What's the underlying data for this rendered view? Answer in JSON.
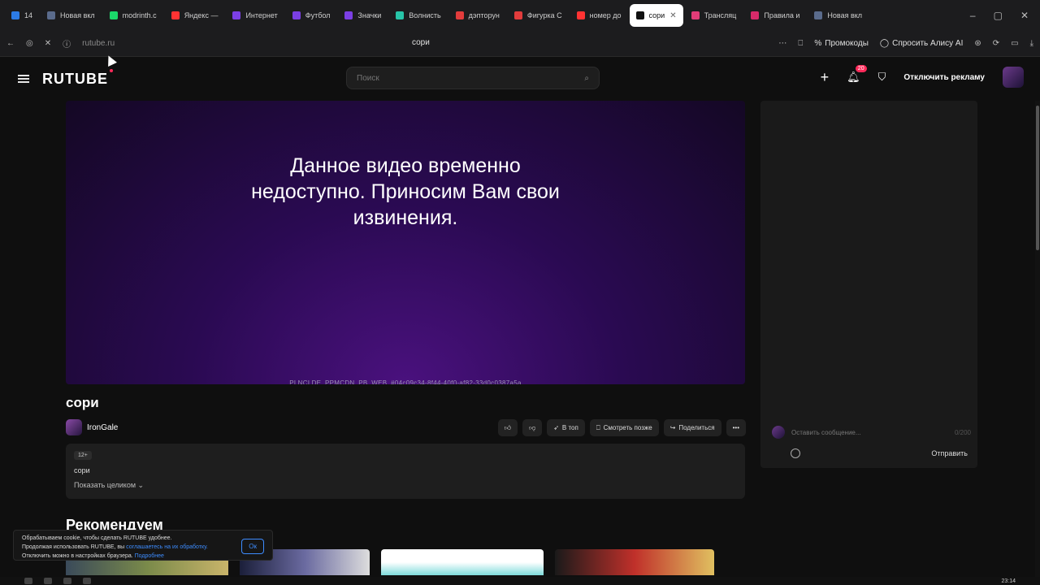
{
  "browser": {
    "tabs": [
      {
        "label": "14",
        "color": "#2c7be5",
        "active": false
      },
      {
        "label": "Новая вкл",
        "color": "#5a6b8c",
        "active": false
      },
      {
        "label": "modrinth.c",
        "color": "#1bd96a",
        "active": false
      },
      {
        "label": "Яндекс —",
        "color": "#ff3333",
        "active": false
      },
      {
        "label": "Интернет",
        "color": "#7b3fe4",
        "active": false
      },
      {
        "label": "Футбол",
        "color": "#7b3fe4",
        "active": false
      },
      {
        "label": "Значки",
        "color": "#7b3fe4",
        "active": false
      },
      {
        "label": "Волнисть",
        "color": "#27c4a8",
        "active": false
      },
      {
        "label": "дэпторун",
        "color": "#e23c3c",
        "active": false
      },
      {
        "label": "Фигурка С",
        "color": "#e23c3c",
        "active": false
      },
      {
        "label": "номер до",
        "color": "#ff3333",
        "active": false
      },
      {
        "label": "сори",
        "color": "#111111",
        "active": true
      },
      {
        "label": "Трансляц",
        "color": "#e23c78",
        "active": false
      },
      {
        "label": "Правила и",
        "color": "#d62a6a",
        "active": false
      },
      {
        "label": "Новая вкл",
        "color": "#5a6b8c",
        "active": false
      }
    ],
    "url": "rutube.ru",
    "page_title": "сори",
    "promo_label": "Промокоды",
    "alice_label": "Спросить Алису AI"
  },
  "header": {
    "logo": "RUTUBE",
    "search_placeholder": "Поиск",
    "notifications_count": "20",
    "disable_ads_label": "Отключить рекламу"
  },
  "player": {
    "message": "Данное видео временно недоступно. Приносим Вам свои извинения.",
    "debug_id": "PLNCLDE_PPMCDN_PB_WEB_#04c09c34-8f44-40f0-af82-33d0c0387a5a"
  },
  "video": {
    "title": "сори",
    "channel": "IronGale",
    "actions": {
      "to_top": "В топ",
      "watch_later": "Смотреть позже",
      "share": "Поделиться"
    },
    "age": "12+",
    "description": "сори",
    "show_more": "Показать целиком"
  },
  "chat": {
    "placeholder": "Оставить сообщение...",
    "counter": "0/200",
    "send": "Отправить"
  },
  "recommend_title": "Рекомендуем",
  "cookie": {
    "line1": "Обрабатываем cookie, чтобы сделать RUTUBE удобнее.",
    "line2": "Продолжая использовать RUTUBE, вы ",
    "line2_link": "соглашаетесь на их обработку.",
    "line3": "Отключить можно в настройках браузера. ",
    "line3_link": "Подробнее",
    "ok": "Ок"
  },
  "taskbar": {
    "clock": "23:14"
  }
}
